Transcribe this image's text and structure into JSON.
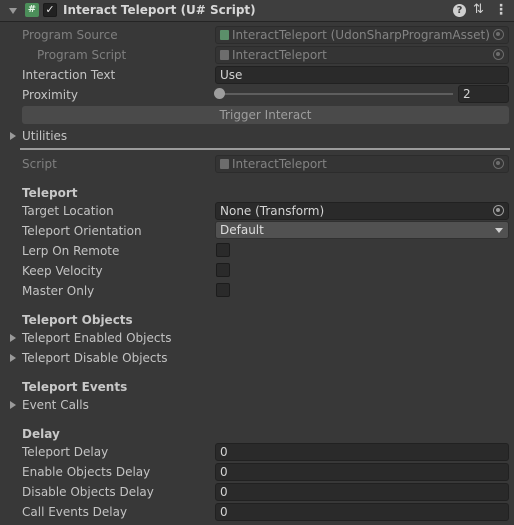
{
  "header": {
    "title": "Interact Teleport (U# Script)",
    "script_icon": "#",
    "enabled_check": "✓",
    "icons": [
      "fold-arrow-icon",
      "csharp-script-icon",
      "help-icon",
      "preset-icon",
      "kebab-menu-icon"
    ]
  },
  "program": {
    "source_label": "Program Source",
    "source_value": "InteractTeleport (UdonSharpProgramAsset)",
    "script_label": "Program Script",
    "script_value": "InteractTeleport"
  },
  "interaction_text": {
    "label": "Interaction Text",
    "value": "Use"
  },
  "proximity": {
    "label": "Proximity",
    "value": "2",
    "slider_fraction": 0.0
  },
  "trigger_button": "Trigger Interact",
  "utilities_label": "Utilities",
  "script_field": {
    "label": "Script",
    "value": "InteractTeleport"
  },
  "teleport": {
    "header": "Teleport",
    "target_label": "Target Location",
    "target_value": "None (Transform)",
    "orientation_label": "Teleport Orientation",
    "orientation_value": "Default",
    "lerp_label": "Lerp On Remote",
    "lerp_checked": false,
    "velocity_label": "Keep Velocity",
    "velocity_checked": false,
    "master_label": "Master Only",
    "master_checked": false
  },
  "teleport_objects": {
    "header": "Teleport Objects",
    "enabled_label": "Teleport Enabled Objects",
    "disable_label": "Teleport Disable Objects"
  },
  "teleport_events": {
    "header": "Teleport Events",
    "calls_label": "Event Calls"
  },
  "delay": {
    "header": "Delay",
    "teleport_label": "Teleport Delay",
    "teleport_value": "0",
    "enable_label": "Enable Objects Delay",
    "enable_value": "0",
    "disable_label": "Disable Objects Delay",
    "disable_value": "0",
    "events_label": "Call Events Delay",
    "events_value": "0"
  },
  "colors": {
    "background": "#383838",
    "header_bg": "#3e3e3e",
    "field_bg": "#2a2a2a",
    "text": "#c4c4c4",
    "dim_text": "#7f7f7f"
  }
}
